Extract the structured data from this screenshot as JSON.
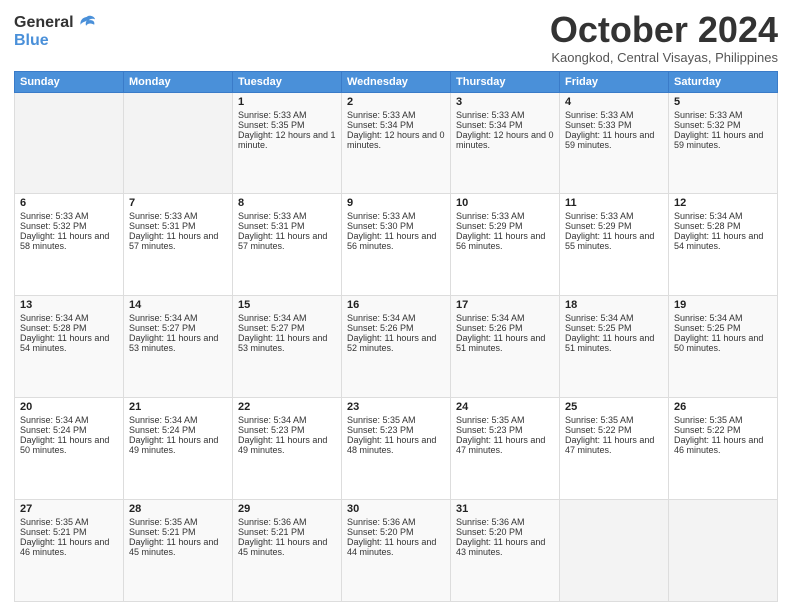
{
  "header": {
    "logo_line1": "General",
    "logo_line2": "Blue",
    "month": "October 2024",
    "location": "Kaongkod, Central Visayas, Philippines"
  },
  "weekdays": [
    "Sunday",
    "Monday",
    "Tuesday",
    "Wednesday",
    "Thursday",
    "Friday",
    "Saturday"
  ],
  "weeks": [
    [
      {
        "day": "",
        "sunrise": "",
        "sunset": "",
        "daylight": ""
      },
      {
        "day": "",
        "sunrise": "",
        "sunset": "",
        "daylight": ""
      },
      {
        "day": "1",
        "sunrise": "Sunrise: 5:33 AM",
        "sunset": "Sunset: 5:35 PM",
        "daylight": "Daylight: 12 hours and 1 minute."
      },
      {
        "day": "2",
        "sunrise": "Sunrise: 5:33 AM",
        "sunset": "Sunset: 5:34 PM",
        "daylight": "Daylight: 12 hours and 0 minutes."
      },
      {
        "day": "3",
        "sunrise": "Sunrise: 5:33 AM",
        "sunset": "Sunset: 5:34 PM",
        "daylight": "Daylight: 12 hours and 0 minutes."
      },
      {
        "day": "4",
        "sunrise": "Sunrise: 5:33 AM",
        "sunset": "Sunset: 5:33 PM",
        "daylight": "Daylight: 11 hours and 59 minutes."
      },
      {
        "day": "5",
        "sunrise": "Sunrise: 5:33 AM",
        "sunset": "Sunset: 5:32 PM",
        "daylight": "Daylight: 11 hours and 59 minutes."
      }
    ],
    [
      {
        "day": "6",
        "sunrise": "Sunrise: 5:33 AM",
        "sunset": "Sunset: 5:32 PM",
        "daylight": "Daylight: 11 hours and 58 minutes."
      },
      {
        "day": "7",
        "sunrise": "Sunrise: 5:33 AM",
        "sunset": "Sunset: 5:31 PM",
        "daylight": "Daylight: 11 hours and 57 minutes."
      },
      {
        "day": "8",
        "sunrise": "Sunrise: 5:33 AM",
        "sunset": "Sunset: 5:31 PM",
        "daylight": "Daylight: 11 hours and 57 minutes."
      },
      {
        "day": "9",
        "sunrise": "Sunrise: 5:33 AM",
        "sunset": "Sunset: 5:30 PM",
        "daylight": "Daylight: 11 hours and 56 minutes."
      },
      {
        "day": "10",
        "sunrise": "Sunrise: 5:33 AM",
        "sunset": "Sunset: 5:29 PM",
        "daylight": "Daylight: 11 hours and 56 minutes."
      },
      {
        "day": "11",
        "sunrise": "Sunrise: 5:33 AM",
        "sunset": "Sunset: 5:29 PM",
        "daylight": "Daylight: 11 hours and 55 minutes."
      },
      {
        "day": "12",
        "sunrise": "Sunrise: 5:34 AM",
        "sunset": "Sunset: 5:28 PM",
        "daylight": "Daylight: 11 hours and 54 minutes."
      }
    ],
    [
      {
        "day": "13",
        "sunrise": "Sunrise: 5:34 AM",
        "sunset": "Sunset: 5:28 PM",
        "daylight": "Daylight: 11 hours and 54 minutes."
      },
      {
        "day": "14",
        "sunrise": "Sunrise: 5:34 AM",
        "sunset": "Sunset: 5:27 PM",
        "daylight": "Daylight: 11 hours and 53 minutes."
      },
      {
        "day": "15",
        "sunrise": "Sunrise: 5:34 AM",
        "sunset": "Sunset: 5:27 PM",
        "daylight": "Daylight: 11 hours and 53 minutes."
      },
      {
        "day": "16",
        "sunrise": "Sunrise: 5:34 AM",
        "sunset": "Sunset: 5:26 PM",
        "daylight": "Daylight: 11 hours and 52 minutes."
      },
      {
        "day": "17",
        "sunrise": "Sunrise: 5:34 AM",
        "sunset": "Sunset: 5:26 PM",
        "daylight": "Daylight: 11 hours and 51 minutes."
      },
      {
        "day": "18",
        "sunrise": "Sunrise: 5:34 AM",
        "sunset": "Sunset: 5:25 PM",
        "daylight": "Daylight: 11 hours and 51 minutes."
      },
      {
        "day": "19",
        "sunrise": "Sunrise: 5:34 AM",
        "sunset": "Sunset: 5:25 PM",
        "daylight": "Daylight: 11 hours and 50 minutes."
      }
    ],
    [
      {
        "day": "20",
        "sunrise": "Sunrise: 5:34 AM",
        "sunset": "Sunset: 5:24 PM",
        "daylight": "Daylight: 11 hours and 50 minutes."
      },
      {
        "day": "21",
        "sunrise": "Sunrise: 5:34 AM",
        "sunset": "Sunset: 5:24 PM",
        "daylight": "Daylight: 11 hours and 49 minutes."
      },
      {
        "day": "22",
        "sunrise": "Sunrise: 5:34 AM",
        "sunset": "Sunset: 5:23 PM",
        "daylight": "Daylight: 11 hours and 49 minutes."
      },
      {
        "day": "23",
        "sunrise": "Sunrise: 5:35 AM",
        "sunset": "Sunset: 5:23 PM",
        "daylight": "Daylight: 11 hours and 48 minutes."
      },
      {
        "day": "24",
        "sunrise": "Sunrise: 5:35 AM",
        "sunset": "Sunset: 5:23 PM",
        "daylight": "Daylight: 11 hours and 47 minutes."
      },
      {
        "day": "25",
        "sunrise": "Sunrise: 5:35 AM",
        "sunset": "Sunset: 5:22 PM",
        "daylight": "Daylight: 11 hours and 47 minutes."
      },
      {
        "day": "26",
        "sunrise": "Sunrise: 5:35 AM",
        "sunset": "Sunset: 5:22 PM",
        "daylight": "Daylight: 11 hours and 46 minutes."
      }
    ],
    [
      {
        "day": "27",
        "sunrise": "Sunrise: 5:35 AM",
        "sunset": "Sunset: 5:21 PM",
        "daylight": "Daylight: 11 hours and 46 minutes."
      },
      {
        "day": "28",
        "sunrise": "Sunrise: 5:35 AM",
        "sunset": "Sunset: 5:21 PM",
        "daylight": "Daylight: 11 hours and 45 minutes."
      },
      {
        "day": "29",
        "sunrise": "Sunrise: 5:36 AM",
        "sunset": "Sunset: 5:21 PM",
        "daylight": "Daylight: 11 hours and 45 minutes."
      },
      {
        "day": "30",
        "sunrise": "Sunrise: 5:36 AM",
        "sunset": "Sunset: 5:20 PM",
        "daylight": "Daylight: 11 hours and 44 minutes."
      },
      {
        "day": "31",
        "sunrise": "Sunrise: 5:36 AM",
        "sunset": "Sunset: 5:20 PM",
        "daylight": "Daylight: 11 hours and 43 minutes."
      },
      {
        "day": "",
        "sunrise": "",
        "sunset": "",
        "daylight": ""
      },
      {
        "day": "",
        "sunrise": "",
        "sunset": "",
        "daylight": ""
      }
    ]
  ]
}
